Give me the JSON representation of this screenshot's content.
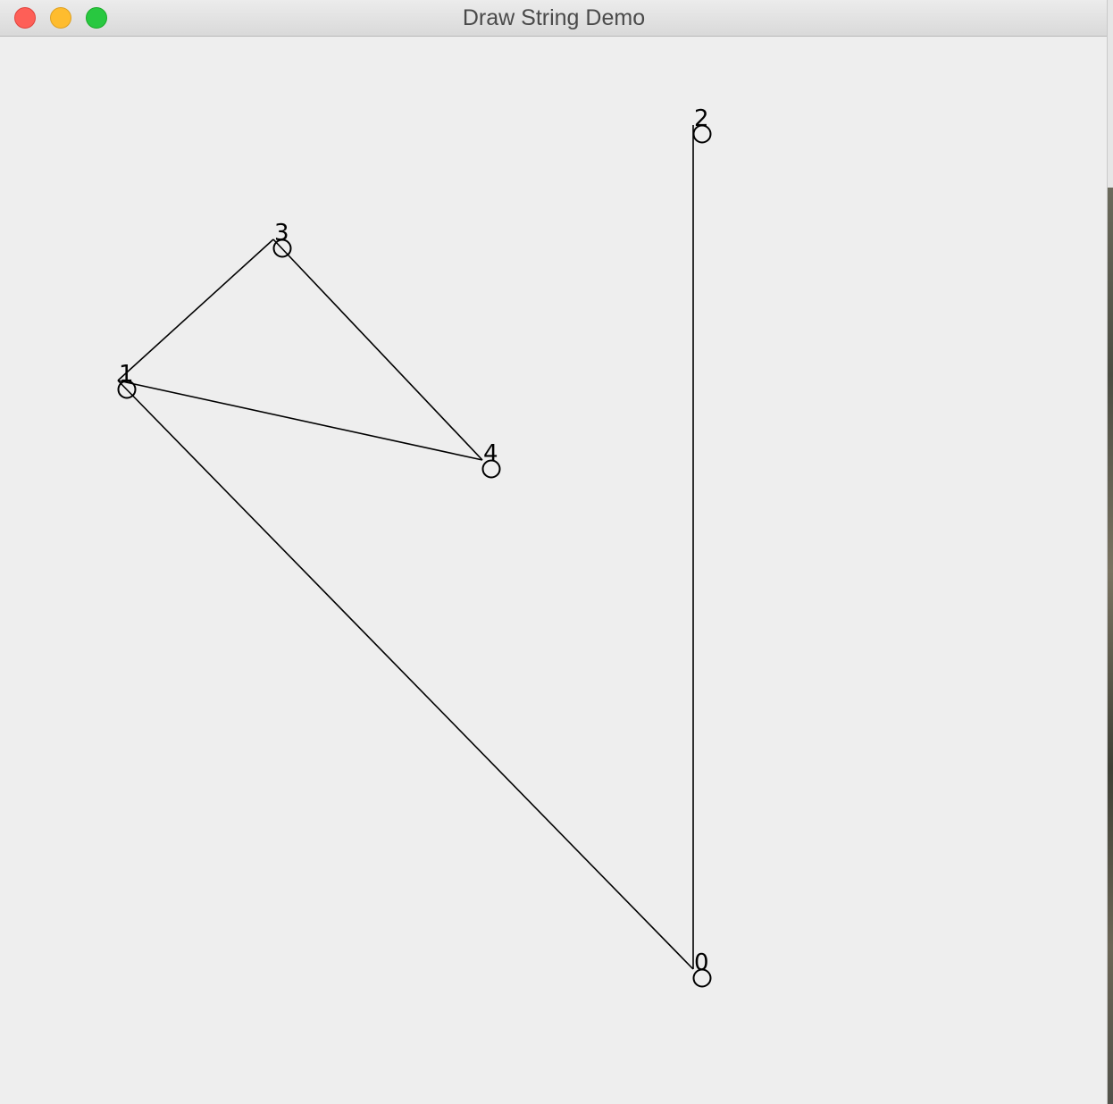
{
  "window": {
    "title": "Draw String Demo",
    "buttons": [
      "close",
      "minimize",
      "zoom"
    ]
  },
  "graph": {
    "nodes": [
      {
        "label": "0"
      },
      {
        "label": "1"
      },
      {
        "label": "2"
      },
      {
        "label": "3"
      },
      {
        "label": "4"
      }
    ],
    "edges": [
      {
        "from": "0",
        "to": "2"
      },
      {
        "from": "0",
        "to": "1"
      },
      {
        "from": "1",
        "to": "3"
      },
      {
        "from": "1",
        "to": "4"
      },
      {
        "from": "3",
        "to": "4"
      }
    ],
    "stroke_color": "#000000"
  }
}
